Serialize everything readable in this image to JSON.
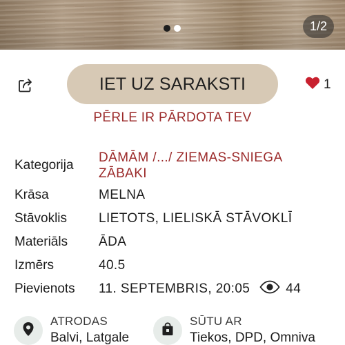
{
  "gallery": {
    "counter": "1/2",
    "dots": [
      "active",
      "inactive"
    ]
  },
  "actions": {
    "main_button": "IET UZ SARAKSTI",
    "likes": "1"
  },
  "status": {
    "sold_text": "PĒRLE IR PĀRDOTA TEV"
  },
  "details": {
    "category_label": "Kategorija",
    "category_value_line1": "DĀMĀM /.../ ZIEMAS-SNIEGA",
    "category_value_line2": "ZĀBAKI",
    "color_label": "Krāsa",
    "color_value": "MELNA",
    "condition_label": "Stāvoklis",
    "condition_value": "LIETOTS, LIELISKĀ STĀVOKLĪ",
    "material_label": "Materiāls",
    "material_value": "ĀDA",
    "size_label": "Izmērs",
    "size_value": "40.5",
    "added_label": "Pievienots",
    "added_value": "11. SEPTEMBRIS, 20:05",
    "views": "44"
  },
  "location": {
    "label": "ATRODAS",
    "value": "Balvi, Latgale"
  },
  "shipping": {
    "label": "SŪTU AR",
    "value": "Tiekos, DPD, Omniva"
  },
  "colors": {
    "accent_red": "#9b2a2a",
    "button_bg": "#d7c9b5",
    "heart": "#c8202e"
  }
}
